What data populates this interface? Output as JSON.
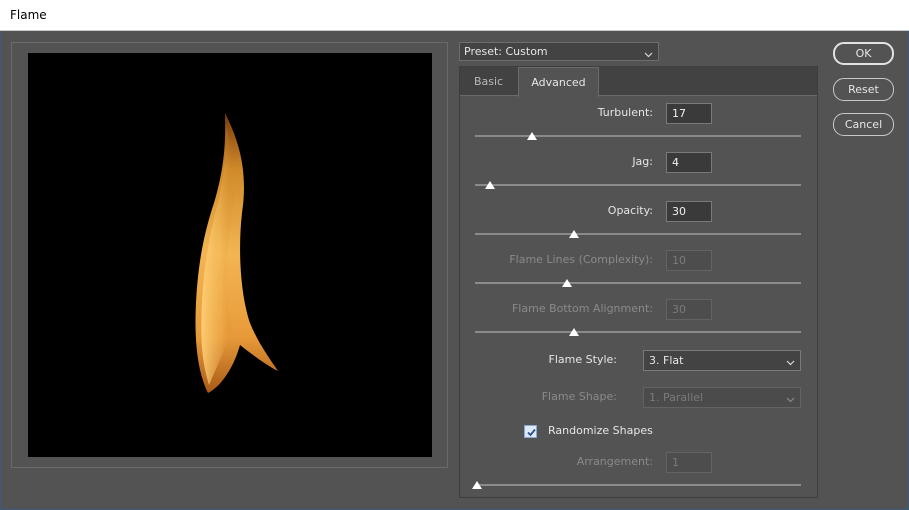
{
  "window": {
    "title": "Flame"
  },
  "preset": {
    "label": "Preset: Custom"
  },
  "tabs": [
    {
      "label": "Basic"
    },
    {
      "label": "Advanced"
    }
  ],
  "settings": {
    "turbulent": {
      "label": "Turbulent:",
      "value": "17",
      "slider_fraction": 0.17
    },
    "jag": {
      "label": "Jag:",
      "value": "4",
      "slider_fraction": 0.04
    },
    "opacity": {
      "label": "Opacity:",
      "value": "30",
      "slider_fraction": 0.3
    },
    "flame_lines": {
      "label": "Flame Lines (Complexity):",
      "value": "10",
      "slider_fraction": 0.28
    },
    "flame_bottom_alignment": {
      "label": "Flame Bottom Alignment:",
      "value": "30",
      "slider_fraction": 0.3
    },
    "flame_style": {
      "label": "Flame Style:",
      "value": "3. Flat"
    },
    "flame_shape": {
      "label": "Flame Shape:",
      "value": "1. Parallel"
    },
    "randomize_shapes": {
      "label": "Randomize Shapes",
      "checked": true
    },
    "arrangement": {
      "label": "Arrangement:",
      "value": "1",
      "slider_fraction": 0.0
    }
  },
  "buttons": {
    "ok": "OK",
    "reset": "Reset",
    "cancel": "Cancel"
  }
}
